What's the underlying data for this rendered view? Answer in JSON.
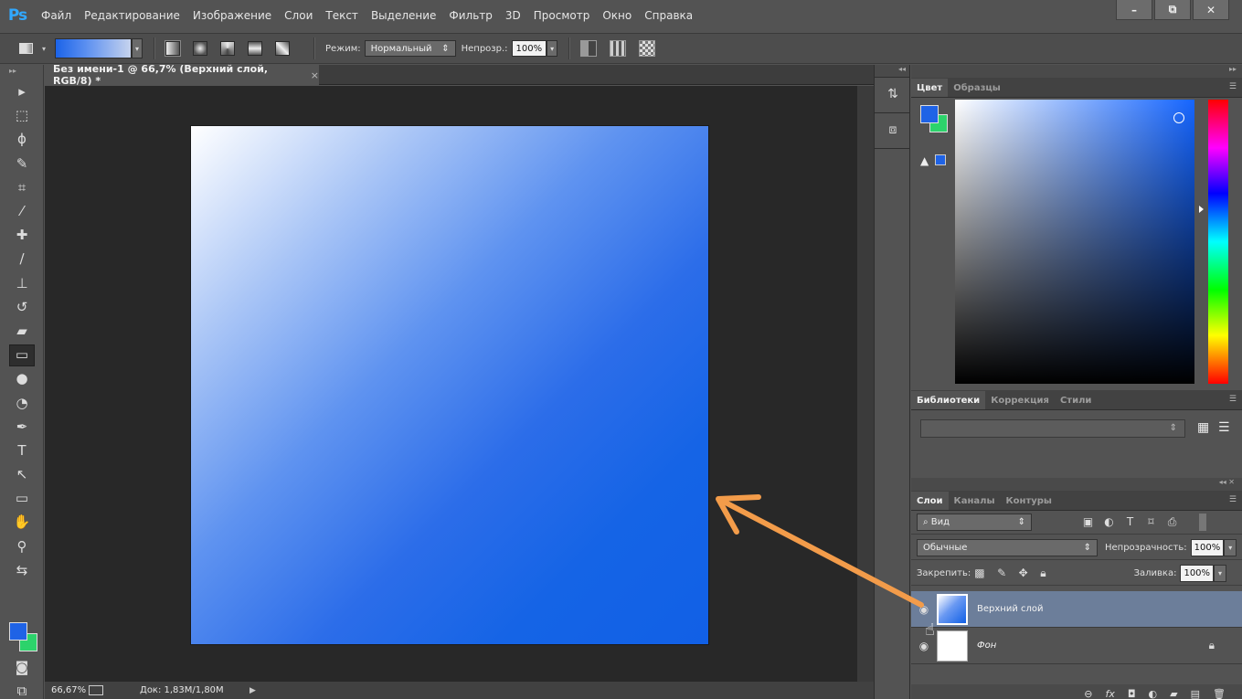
{
  "app": {
    "logo": "Ps"
  },
  "menu": [
    "Файл",
    "Редактирование",
    "Изображение",
    "Слои",
    "Текст",
    "Выделение",
    "Фильтр",
    "3D",
    "Просмотр",
    "Окно",
    "Справка"
  ],
  "window_controls": {
    "minimize": "–",
    "restore": "⧉",
    "close": "✕"
  },
  "options": {
    "mode_label": "Режим:",
    "mode_value": "Нормальный",
    "opacity_label": "Непрозр.:",
    "opacity_value": "100%",
    "gradient_colors": [
      "#1b63e8",
      "#c6d3ee"
    ]
  },
  "document": {
    "tab_title": "Без имени-1 @ 66,7% (Верхний слой, RGB/8) *",
    "tab_close": "×",
    "gradient": {
      "from": "#ffffff",
      "to": "#1160e6",
      "direction": "top-left to bottom-right"
    }
  },
  "status": {
    "zoom": "66,67%",
    "doc_size": "Док: 1,83M/1,80M",
    "play": "▶"
  },
  "tools": [
    {
      "name": "move-tool-icon",
      "glyph": "▸"
    },
    {
      "name": "marquee-tool-icon",
      "glyph": "⬚"
    },
    {
      "name": "lasso-tool-icon",
      "glyph": "ϕ"
    },
    {
      "name": "quick-select-tool-icon",
      "glyph": "✎"
    },
    {
      "name": "crop-tool-icon",
      "glyph": "⌗"
    },
    {
      "name": "eyedropper-tool-icon",
      "glyph": "⁄"
    },
    {
      "name": "healing-brush-tool-icon",
      "glyph": "✚"
    },
    {
      "name": "brush-tool-icon",
      "glyph": "∕"
    },
    {
      "name": "clone-stamp-tool-icon",
      "glyph": "⊥"
    },
    {
      "name": "history-brush-tool-icon",
      "glyph": "↺"
    },
    {
      "name": "eraser-tool-icon",
      "glyph": "▰"
    },
    {
      "name": "gradient-tool-icon",
      "glyph": "▭"
    },
    {
      "name": "blur-tool-icon",
      "glyph": "●"
    },
    {
      "name": "dodge-tool-icon",
      "glyph": "◔"
    },
    {
      "name": "pen-tool-icon",
      "glyph": "✒"
    },
    {
      "name": "type-tool-icon",
      "glyph": "T"
    },
    {
      "name": "path-select-tool-icon",
      "glyph": "↖"
    },
    {
      "name": "rectangle-tool-icon",
      "glyph": "▭"
    },
    {
      "name": "hand-tool-icon",
      "glyph": "✋"
    },
    {
      "name": "zoom-tool-icon",
      "glyph": "⚲"
    },
    {
      "name": "swap-colors-icon",
      "glyph": "⇆"
    }
  ],
  "active_tool": "gradient-tool-icon",
  "colors": {
    "foreground": "#1f63e6",
    "background": "#2cd36b"
  },
  "color_panel": {
    "tabs": [
      "Цвет",
      "Образцы"
    ],
    "gamut_warning": "▲"
  },
  "libraries_panel": {
    "tabs": [
      "Библиотеки",
      "Коррекция",
      "Стили"
    ]
  },
  "layers_panel": {
    "tabs": [
      "Слои",
      "Каналы",
      "Контуры"
    ],
    "filter_label": "Вид",
    "filter_prefix": "⌕",
    "blend_mode": "Обычные",
    "opacity_label": "Непрозрачность:",
    "opacity_value": "100%",
    "lock_label": "Закрепить:",
    "fill_label": "Заливка:",
    "fill_value": "100%",
    "layers": [
      {
        "name": "Верхний слой",
        "selected": true,
        "locked": false
      },
      {
        "name": "Фон",
        "selected": false,
        "locked": true
      }
    ]
  },
  "annotation": {
    "arrow_color": "#f39c4a"
  }
}
